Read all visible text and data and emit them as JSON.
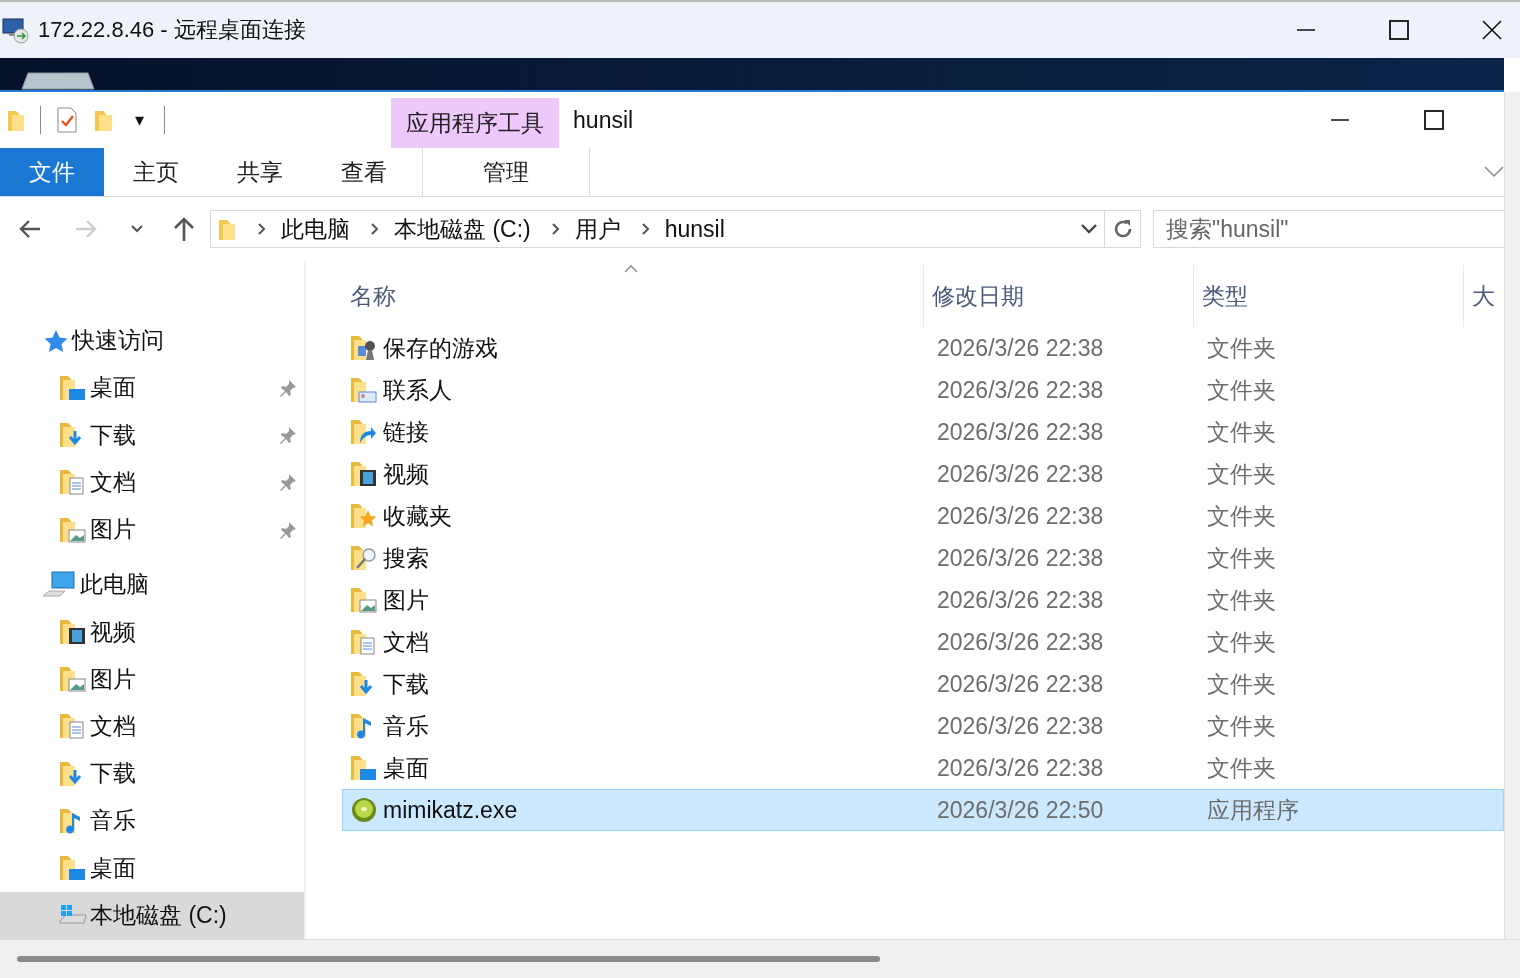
{
  "window": {
    "title": "172.22.8.46 - 远程桌面连接"
  },
  "explorer": {
    "title": "hunsil",
    "quick_toolbar": {
      "customize_caret": "▾"
    },
    "ribbon_tabs": [
      {
        "label": "文件",
        "kind": "file"
      },
      {
        "label": "主页",
        "kind": "tab"
      },
      {
        "label": "共享",
        "kind": "tab"
      },
      {
        "label": "查看",
        "kind": "tab"
      },
      {
        "label": "管理",
        "kind": "context"
      }
    ],
    "context_group": "应用程序工具",
    "breadcrumb": [
      "此电脑",
      "本地磁盘 (C:)",
      "用户",
      "hunsil"
    ],
    "search": {
      "placeholder": "搜索\"hunsil\""
    },
    "sidebar": [
      {
        "label": "快速访问",
        "kind": "quick",
        "children": [
          {
            "label": "桌面",
            "kind": "desktop",
            "pinned": true,
            "selected": false
          },
          {
            "label": "下载",
            "kind": "download",
            "pinned": true,
            "selected": false
          },
          {
            "label": "文档",
            "kind": "document",
            "pinned": true,
            "selected": false
          },
          {
            "label": "图片",
            "kind": "picture",
            "pinned": true,
            "selected": false
          }
        ]
      },
      {
        "label": "此电脑",
        "kind": "pc",
        "children": [
          {
            "label": "视频",
            "kind": "video",
            "pinned": false,
            "selected": false
          },
          {
            "label": "图片",
            "kind": "picture",
            "pinned": false,
            "selected": false
          },
          {
            "label": "文档",
            "kind": "document",
            "pinned": false,
            "selected": false
          },
          {
            "label": "下载",
            "kind": "download",
            "pinned": false,
            "selected": false
          },
          {
            "label": "音乐",
            "kind": "music",
            "pinned": false,
            "selected": false
          },
          {
            "label": "桌面",
            "kind": "desktop",
            "pinned": false,
            "selected": false
          },
          {
            "label": "本地磁盘 (C:)",
            "kind": "drive",
            "pinned": false,
            "selected": true
          }
        ]
      }
    ],
    "columns": [
      "名称",
      "修改日期",
      "类型",
      "大"
    ],
    "rows": [
      {
        "name": "保存的游戏",
        "date": "2026/3/26 22:38",
        "type": "文件夹",
        "kind": "games",
        "selected": false
      },
      {
        "name": "联系人",
        "date": "2026/3/26 22:38",
        "type": "文件夹",
        "kind": "contacts",
        "selected": false
      },
      {
        "name": "链接",
        "date": "2026/3/26 22:38",
        "type": "文件夹",
        "kind": "links",
        "selected": false
      },
      {
        "name": "视频",
        "date": "2026/3/26 22:38",
        "type": "文件夹",
        "kind": "video",
        "selected": false
      },
      {
        "name": "收藏夹",
        "date": "2026/3/26 22:38",
        "type": "文件夹",
        "kind": "favorites",
        "selected": false
      },
      {
        "name": "搜索",
        "date": "2026/3/26 22:38",
        "type": "文件夹",
        "kind": "search",
        "selected": false
      },
      {
        "name": "图片",
        "date": "2026/3/26 22:38",
        "type": "文件夹",
        "kind": "picture",
        "selected": false
      },
      {
        "name": "文档",
        "date": "2026/3/26 22:38",
        "type": "文件夹",
        "kind": "document",
        "selected": false
      },
      {
        "name": "下载",
        "date": "2026/3/26 22:38",
        "type": "文件夹",
        "kind": "download",
        "selected": false
      },
      {
        "name": "音乐",
        "date": "2026/3/26 22:38",
        "type": "文件夹",
        "kind": "music",
        "selected": false
      },
      {
        "name": "桌面",
        "date": "2026/3/26 22:38",
        "type": "文件夹",
        "kind": "desktop",
        "selected": false
      },
      {
        "name": "mimikatz.exe",
        "date": "2026/3/26 22:50",
        "type": "应用程序",
        "kind": "exe",
        "selected": true
      }
    ]
  }
}
